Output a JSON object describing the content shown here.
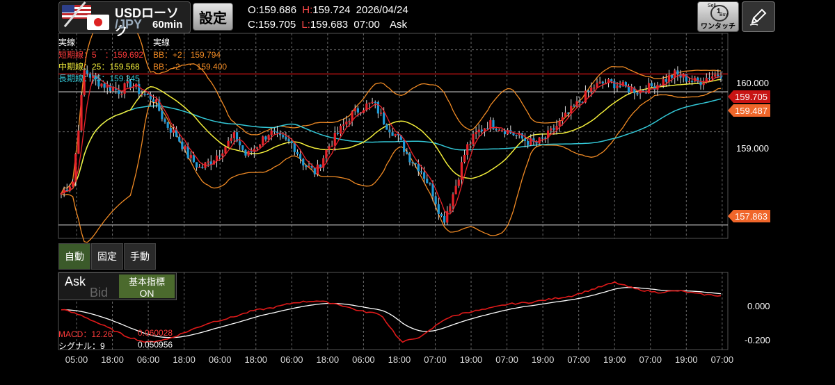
{
  "header": {
    "pair_top": "USDローソク",
    "pair_bottom": "/JPY",
    "timeframe": "60min",
    "settings_label": "設定",
    "open_label": "O:",
    "open": "159.686",
    "high_label": "H:",
    "high": "159.724",
    "date": "2026/04/24",
    "close_label": "C:",
    "close": "159.705",
    "low_label": "L:",
    "low": "159.683",
    "time": "07:00",
    "price_side": "Ask",
    "one_touch_label": "ワンタッチ",
    "sell_label": "Sell",
    "buy_label": "Buy",
    "one_label": "1"
  },
  "legend": {
    "left_title": "実線",
    "right_title": "実線",
    "short_ma": "短期線：5　：159.692",
    "mid_ma": "中期線：25：159.568",
    "long_ma": "長期線：75：159.345",
    "bb_plus": "BB：+2：159.794",
    "bb_minus": "BB：-2　：159.400"
  },
  "price_axis": {
    "ticks": [
      "160.000",
      "159.000"
    ],
    "current_ask": "159.705",
    "current_bid": "159.487",
    "low_marker": "157.863"
  },
  "scale_modes": [
    "自動",
    "固定",
    "手動"
  ],
  "indicator_toggle": {
    "ask": "Ask",
    "bid": "Bid",
    "label": "基本指標",
    "state": "ON"
  },
  "macd": {
    "macd_label": "MACD：12.26",
    "macd_value": "0.060028",
    "signal_label": "シグナル：9",
    "signal_value": "0.050956",
    "ticks": [
      "0.000",
      "-0.200"
    ]
  },
  "time_axis": [
    "05:00",
    "18:00",
    "06:00",
    "18:00",
    "06:00",
    "18:00",
    "06:00",
    "18:00",
    "06:00",
    "18:00",
    "07:00",
    "19:00",
    "07:00",
    "19:00",
    "07:00",
    "19:00",
    "07:00",
    "19:00",
    "07:00"
  ],
  "colors": {
    "up": "#e8232a",
    "down": "#1e9ad6",
    "short_ma": "#e8232a",
    "mid_ma": "#f3ee3a",
    "long_ma": "#33c7d6",
    "bb": "#f08a24",
    "macd": "#e11a1a",
    "signal": "#ffffff"
  },
  "chart_data": {
    "type": "candlestick",
    "interval": "60min",
    "ylim": [
      157.7,
      160.2
    ],
    "key_levels": [
      159.705,
      159.487,
      157.863
    ],
    "close_path": [
      158.25,
      158.4,
      159.75,
      159.62,
      159.55,
      159.5,
      159.58,
      159.47,
      159.4,
      159.1,
      158.95,
      158.7,
      158.55,
      158.65,
      158.8,
      158.95,
      158.7,
      158.85,
      159.0,
      158.9,
      158.85,
      158.6,
      158.5,
      158.8,
      159.0,
      159.2,
      159.3,
      159.35,
      159.1,
      158.95,
      158.7,
      158.55,
      158.3,
      157.9,
      158.3,
      158.8,
      159.0,
      159.1,
      159.05,
      158.98,
      158.9,
      158.85,
      158.95,
      159.1,
      159.25,
      159.4,
      159.55,
      159.6,
      159.58,
      159.52,
      159.5,
      159.55,
      159.62,
      159.7,
      159.65,
      159.6,
      159.68,
      159.705
    ],
    "macd_path": [
      -0.02,
      -0.06,
      -0.12,
      -0.18,
      -0.22,
      -0.2,
      -0.15,
      -0.1,
      -0.07,
      -0.03,
      -0.01,
      0.02,
      0.03,
      0.01,
      -0.03,
      -0.05,
      -0.22,
      -0.18,
      -0.08,
      -0.04,
      -0.02,
      0.01,
      0.02,
      0.04,
      0.06,
      0.1,
      0.14,
      0.1,
      0.08,
      0.09,
      0.07,
      0.06
    ]
  }
}
